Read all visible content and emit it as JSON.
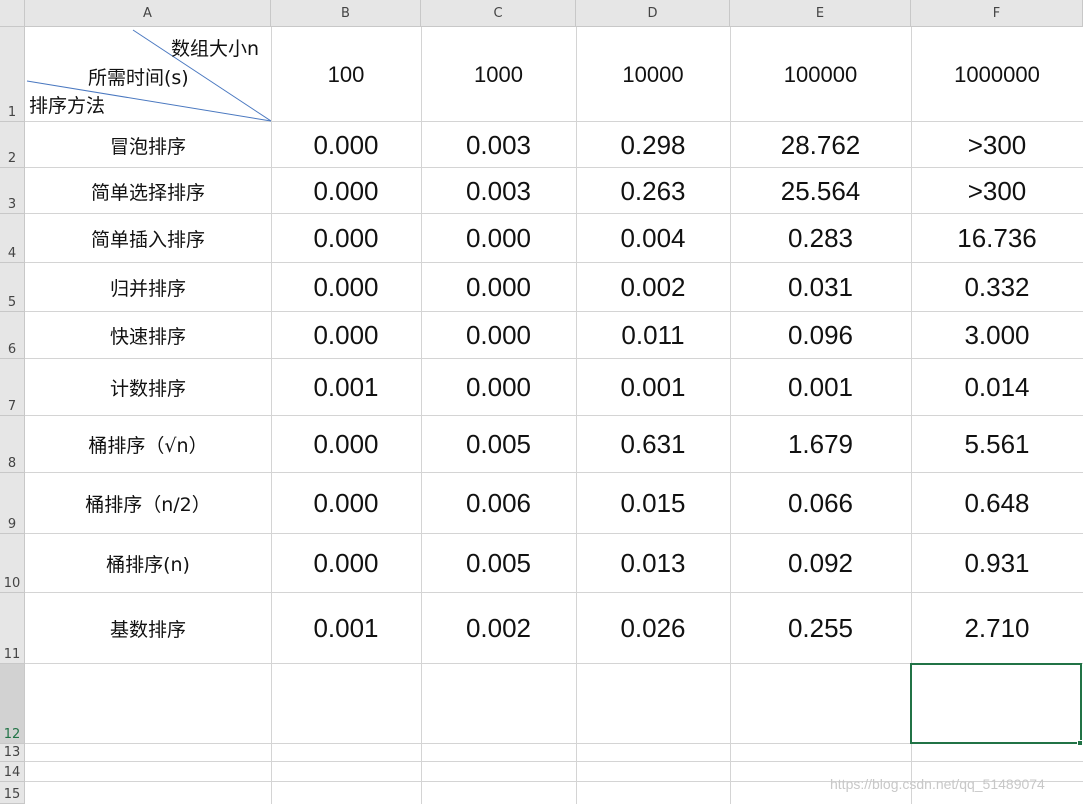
{
  "columns": [
    "A",
    "B",
    "C",
    "D",
    "E",
    "F"
  ],
  "row_numbers": [
    "1",
    "2",
    "3",
    "4",
    "5",
    "6",
    "7",
    "8",
    "9",
    "10",
    "11",
    "12",
    "13",
    "14",
    "15"
  ],
  "header_cell": {
    "top_right": "数组大小n",
    "middle": "所需时间(s)",
    "bottom_left": "排序方法"
  },
  "sizes": [
    "100",
    "1000",
    "10000",
    "100000",
    "1000000"
  ],
  "rows": [
    {
      "method": "冒泡排序",
      "values": [
        "0.000",
        "0.003",
        "0.298",
        "28.762",
        ">300"
      ]
    },
    {
      "method": "简单选择排序",
      "values": [
        "0.000",
        "0.003",
        "0.263",
        "25.564",
        ">300"
      ]
    },
    {
      "method": "简单插入排序",
      "values": [
        "0.000",
        "0.000",
        "0.004",
        "0.283",
        "16.736"
      ]
    },
    {
      "method": "归并排序",
      "values": [
        "0.000",
        "0.000",
        "0.002",
        "0.031",
        "0.332"
      ]
    },
    {
      "method": "快速排序",
      "values": [
        "0.000",
        "0.000",
        "0.011",
        "0.096",
        "3.000"
      ]
    },
    {
      "method": "计数排序",
      "values": [
        "0.001",
        "0.000",
        "0.001",
        "0.001",
        "0.014"
      ]
    },
    {
      "method": "桶排序（√n）",
      "values": [
        "0.000",
        "0.005",
        "0.631",
        "1.679",
        "5.561"
      ]
    },
    {
      "method": "桶排序（n/2）",
      "values": [
        "0.000",
        "0.006",
        "0.015",
        "0.066",
        "0.648"
      ]
    },
    {
      "method": "桶排序(n)",
      "values": [
        "0.000",
        "0.005",
        "0.013",
        "0.092",
        "0.931"
      ]
    },
    {
      "method": "基数排序",
      "values": [
        "0.001",
        "0.002",
        "0.026",
        "0.255",
        "2.710"
      ]
    }
  ],
  "selected_cell": "F12",
  "watermark": "https://blog.csdn.net/qq_51489074",
  "colors": {
    "accent": "#217346",
    "header_bg": "#e6e6e6",
    "grid": "#d4d4d4"
  }
}
